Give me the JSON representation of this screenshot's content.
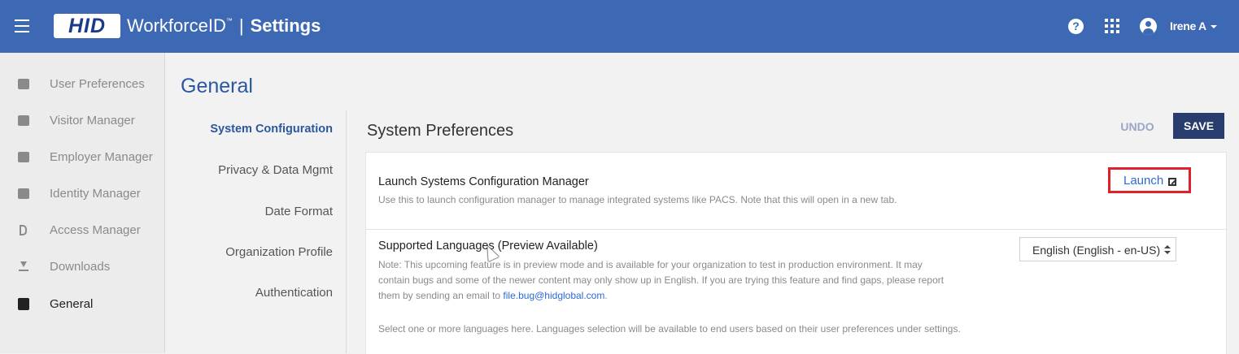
{
  "header": {
    "logo_text": "HID",
    "product": "WorkforceID",
    "trademark": "™",
    "separator": "|",
    "section": "Settings",
    "user_name": "Irene A"
  },
  "sidebar": {
    "items": [
      {
        "label": "User Preferences",
        "icon": "user-card-icon",
        "active": false
      },
      {
        "label": "Visitor Manager",
        "icon": "visitor-badge-icon",
        "active": false
      },
      {
        "label": "Employer Manager",
        "icon": "employer-badge-icon",
        "active": false
      },
      {
        "label": "Identity Manager",
        "icon": "folder-id-icon",
        "active": false
      },
      {
        "label": "Access Manager",
        "icon": "door-icon",
        "active": false
      },
      {
        "label": "Downloads",
        "icon": "download-icon",
        "active": false
      },
      {
        "label": "General",
        "icon": "general-settings-icon",
        "active": true
      }
    ]
  },
  "page": {
    "title": "General"
  },
  "subnav": {
    "items": [
      {
        "label": "System Configuration",
        "active": true
      },
      {
        "label": "Privacy & Data Mgmt",
        "active": false
      },
      {
        "label": "Date Format",
        "active": false
      },
      {
        "label": "Organization Profile",
        "active": false
      },
      {
        "label": "Authentication",
        "active": false
      }
    ]
  },
  "content": {
    "title": "System Preferences",
    "undo_label": "UNDO",
    "save_label": "SAVE",
    "launch_section": {
      "title": "Launch Systems Configuration Manager",
      "description": "Use this to launch configuration manager to manage integrated systems like PACS. Note that this will open in a new tab.",
      "launch_label": "Launch"
    },
    "languages_section": {
      "title": "Supported Languages (Preview Available)",
      "note_line1": "Note: This upcoming feature is in preview mode and is available for your organization to test in production environment. It may",
      "note_line2": "contain bugs and some of the newer content may only show up in English. If you are trying this feature and find gaps, please report",
      "note_line3_prefix": "them by sending an email to ",
      "email": "file.bug@hidglobal.com",
      "note_line3_suffix": ".",
      "selection_help": "Select one or more languages here. Languages selection will be available to end users based on their user preferences under settings.",
      "selected_language": "English (English - en-US)"
    }
  },
  "colors": {
    "header_bg": "#3d68b3",
    "save_bg": "#283d6e",
    "accent_blue": "#2b57a0",
    "highlight_red": "#e0202a"
  }
}
